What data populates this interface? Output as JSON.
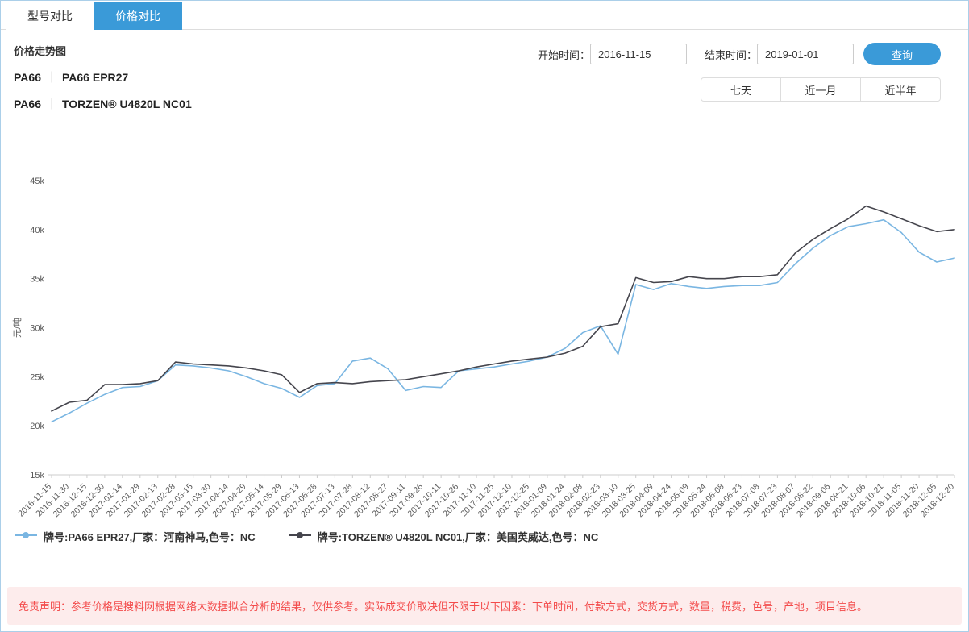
{
  "colors": {
    "accent": "#3a9ad8",
    "axis_text": "#5a5a5a",
    "axis_line": "#cccccc",
    "disclaimer_bg": "#fdecec",
    "disclaimer_text": "#f34b4b"
  },
  "tabs": [
    {
      "label": "型号对比"
    },
    {
      "label": "价格对比"
    }
  ],
  "header": {
    "title": "价格走势图",
    "products": [
      {
        "category": "PA66",
        "separator": "｜",
        "name": "PA66 EPR27"
      },
      {
        "category": "PA66",
        "separator": "｜",
        "name": "TORZEN® U4820L NC01"
      }
    ],
    "filters": {
      "start_label": "开始时间：",
      "start_value": "2016-11-15",
      "end_label": "结束时间：",
      "end_value": "2019-01-01",
      "query_label": "查询",
      "ranges": [
        {
          "label": "七天"
        },
        {
          "label": "近一月"
        },
        {
          "label": "近半年"
        }
      ]
    }
  },
  "legend": [
    {
      "label": "牌号:PA66 EPR27,厂家：河南神马,色号：NC",
      "color": "#7ab6e2"
    },
    {
      "label": "牌号:TORZEN® U4820L NC01,厂家：美国英威达,色号：NC",
      "color": "#45454d"
    }
  ],
  "disclaimer": "免责声明：参考价格是搜料网根据网络大数据拟合分析的结果，仅供参考。实际成交价取决但不限于以下因素：下单时间，付款方式，交货方式，数量，税费，色号，产地，项目信息。",
  "chart_data": {
    "type": "line",
    "title": "",
    "xlabel": "",
    "ylabel": "元/吨",
    "ylim": [
      15000,
      45000
    ],
    "grid": false,
    "legend_position": "bottom-left",
    "yticks": [
      {
        "value": 15000,
        "label": "15k"
      },
      {
        "value": 20000,
        "label": "20k"
      },
      {
        "value": 25000,
        "label": "25k"
      },
      {
        "value": 30000,
        "label": "30k"
      },
      {
        "value": 35000,
        "label": "35k"
      },
      {
        "value": 40000,
        "label": "40k"
      },
      {
        "value": 45000,
        "label": "45k"
      }
    ],
    "categories": [
      "2016-11-15",
      "2016-11-30",
      "2016-12-15",
      "2016-12-30",
      "2017-01-14",
      "2017-01-29",
      "2017-02-13",
      "2017-02-28",
      "2017-03-15",
      "2017-03-30",
      "2017-04-14",
      "2017-04-29",
      "2017-05-14",
      "2017-05-29",
      "2017-06-13",
      "2017-06-28",
      "2017-07-13",
      "2017-07-28",
      "2017-08-12",
      "2017-08-27",
      "2017-09-11",
      "2017-09-26",
      "2017-10-11",
      "2017-10-26",
      "2017-11-10",
      "2017-11-25",
      "2017-12-10",
      "2017-12-25",
      "2018-01-09",
      "2018-01-24",
      "2018-02-08",
      "2018-02-23",
      "2018-03-10",
      "2018-03-25",
      "2018-04-09",
      "2018-04-24",
      "2018-05-09",
      "2018-05-24",
      "2018-06-08",
      "2018-06-23",
      "2018-07-08",
      "2018-07-23",
      "2018-08-07",
      "2018-08-22",
      "2018-09-06",
      "2018-09-21",
      "2018-10-06",
      "2018-10-21",
      "2018-11-05",
      "2018-11-20",
      "2018-12-05",
      "2018-12-20"
    ],
    "series": [
      {
        "name": "PA66 EPR27",
        "color": "#7ab6e2",
        "values": [
          20400,
          21300,
          22300,
          23200,
          23900,
          24000,
          24600,
          26200,
          26100,
          25900,
          25600,
          25000,
          24300,
          23800,
          22900,
          24100,
          24300,
          26600,
          26900,
          25800,
          23600,
          24000,
          23900,
          25600,
          25800,
          26000,
          26300,
          26600,
          27000,
          27900,
          29500,
          30200,
          27300,
          34400,
          33900,
          34500,
          34200,
          34000,
          34200,
          34300,
          34300,
          34600,
          36500,
          38100,
          39400,
          40300,
          40600,
          41000,
          39700,
          37700,
          36700,
          37100
        ]
      },
      {
        "name": "TORZEN® U4820L NC01",
        "color": "#45454d",
        "values": [
          21500,
          22400,
          22600,
          24200,
          24200,
          24300,
          24600,
          26500,
          26300,
          26200,
          26100,
          25900,
          25600,
          25200,
          23400,
          24300,
          24400,
          24300,
          24500,
          24600,
          24700,
          25000,
          25300,
          25600,
          26000,
          26300,
          26600,
          26800,
          27000,
          27400,
          28100,
          30100,
          30400,
          35100,
          34600,
          34700,
          35200,
          35000,
          35000,
          35200,
          35200,
          35400,
          37600,
          39000,
          40100,
          41100,
          42400,
          41800,
          41100,
          40400,
          39800,
          40000
        ]
      }
    ]
  }
}
